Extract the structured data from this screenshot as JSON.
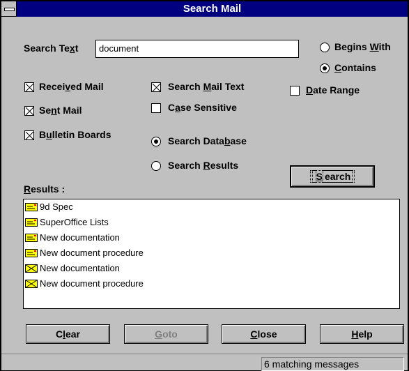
{
  "window": {
    "title": "Search Mail"
  },
  "search": {
    "label_pre": "Search Te",
    "label_u": "x",
    "label_post": "t",
    "value": "document"
  },
  "match_mode": {
    "begins_with": {
      "pre": "Begins ",
      "u": "W",
      "post": "ith",
      "selected": false
    },
    "contains": {
      "pre": "",
      "u": "C",
      "post": "ontains",
      "selected": true
    }
  },
  "options": {
    "received_mail": {
      "pre": "Recei",
      "u": "v",
      "post": "ed Mail",
      "checked": true
    },
    "sent_mail": {
      "pre": "Se",
      "u": "n",
      "post": "t Mail",
      "checked": true
    },
    "bulletin_boards": {
      "pre": "B",
      "u": "u",
      "post": "lletin Boards",
      "checked": true
    },
    "search_mail_text": {
      "pre": "Search ",
      "u": "M",
      "post": "ail Text",
      "checked": true
    },
    "case_sensitive": {
      "pre": "C",
      "u": "a",
      "post": "se Sensitive",
      "checked": false
    },
    "date_range": {
      "pre": "",
      "u": "D",
      "post": "ate Range",
      "checked": false
    }
  },
  "scope": {
    "search_database": {
      "pre": "Search Data",
      "u": "b",
      "post": "ase",
      "selected": true
    },
    "search_results": {
      "pre": "Search ",
      "u": "R",
      "post": "esults",
      "selected": false
    }
  },
  "search_button": {
    "pre": "",
    "u": "S",
    "post": "earch"
  },
  "results": {
    "label_pre": "",
    "label_u": "R",
    "label_post": "esults :",
    "items": [
      {
        "text": "9d Spec",
        "icon": "mail-read-icon"
      },
      {
        "text": "SuperOffice Lists",
        "icon": "mail-read-icon"
      },
      {
        "text": "New documentation",
        "icon": "mail-read-icon"
      },
      {
        "text": "New document procedure",
        "icon": "mail-read-icon"
      },
      {
        "text": "New documentation",
        "icon": "mail-unread-icon"
      },
      {
        "text": "New document procedure",
        "icon": "mail-unread-icon"
      }
    ]
  },
  "buttons": {
    "clear": {
      "pre": "C",
      "u": "l",
      "post": "ear",
      "enabled": true
    },
    "goto": {
      "pre": "",
      "u": "G",
      "post": "oto",
      "enabled": false
    },
    "close": {
      "pre": "",
      "u": "C",
      "post": "lose",
      "enabled": true
    },
    "help": {
      "pre": "",
      "u": "H",
      "post": "elp",
      "enabled": true
    }
  },
  "status": {
    "text": "6 matching messages"
  },
  "colors": {
    "titlebar": "#000080",
    "face": "#c0c0c0",
    "mail_icon": "#ffff00"
  }
}
